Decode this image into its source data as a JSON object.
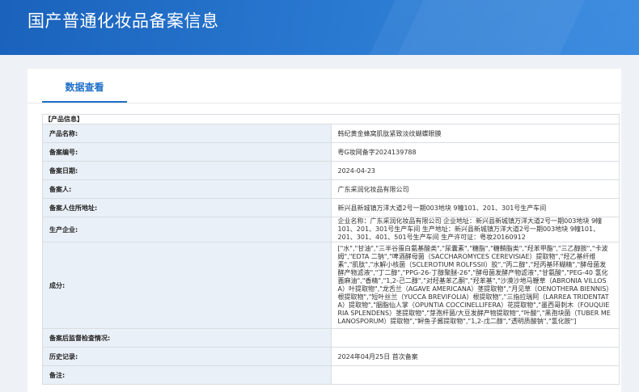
{
  "header": {
    "title": "国产普通化妆品备案信息"
  },
  "tabs": [
    {
      "label": "数据查看"
    }
  ],
  "section": {
    "title": "【产品信息】"
  },
  "rows": [
    {
      "label": "产品名称:",
      "value": "韩纪黄金蜂窝肌肽紧致淡纹蝴蝶眼膜"
    },
    {
      "label": "备案编号:",
      "value": "粤G妆网备字2024139788"
    },
    {
      "label": "备案日期:",
      "value": "2024-04-23"
    },
    {
      "label": "备案人:",
      "value": "广东采润化妆品有限公司"
    },
    {
      "label": "备案人住所地址:",
      "value": "新兴县新城镇万洋大道2号一期003地块 9幢101、201、301号生产车间"
    },
    {
      "label": "生产企业:",
      "value": "企业名称：广东采润化妆品有限公司 企业地址：新兴县新城镇万洋大道2号一期003地块 9幢101、201、301号生产车间 生产地址：新兴县新城镇万洋大道2号一期003地块 9幢101、201、301、401、501号生产车间 生产许可证：粤妆20160912"
    },
    {
      "label": "成分:",
      "value": "[\"水\",\"甘油\",\"三半谷蛋白氨基酸类\",\"尿囊素\",\"糖脂\",\"糖鞘脂类\",\"羟苯甲酯\",\"三乙醇胺\",\"卡波姆\",\"EDTA 二钠\",\"啤酒酵母菌（SACCHAROMYCES CEREVISIAE）提取物\",\"羟乙基纤维素\",\"肌肽\",\"水解小核菌（SCLEROTIUM ROLFSSII）胶\",\"丙二醇\",\"羟丙基环糊精\",\"酵母菌发酵产物滤液\",\"丁二醇\",\"PPG-26-丁醇聚醚-26\",\"酵母菌发酵产物滤液\",\"甘氨酸\",\"PEG-40 氢化蓖麻油\",\"香精\",\"1,2-己二醇\",\"对羟基苯乙酮\",\"羟苯基\",\"沙漠沙地马鞭草（ABRONIA VILLOSA）叶提取物\",\"龙舌兰（AGAVE AMERICANA）茎提取物\",\"月见草（OENOTHERA BIENNIS）根提取物\",\"短叶丝兰（YUCCA BREVIFOLIA）根提取物\",\"三指拉瑞阿（LARREA TRIDENTATA）提取物\",\"胭脂仙人掌（OPUNTIA COCCINELLIFERA）花提取物\",\"墨西哥刺木（FOUQUIERIA SPLENDENS）茎提取物\",\"芽孢杆菌/大豆发酵产物提取物\",\"叶酸\",\"黑孢块菌（TUBER MELANOSPORUM）提取物\",\"鲟鱼子酱提取物\",\"1,2-戊二醇\",\"透明质酸钠\",\"氢化胺\"]"
    },
    {
      "label": "备案后监督检查情况:",
      "value": ""
    },
    {
      "label": "历史记录:",
      "value": "2024年04月25日 首次备案"
    },
    {
      "label": "备注:",
      "value": ""
    }
  ]
}
